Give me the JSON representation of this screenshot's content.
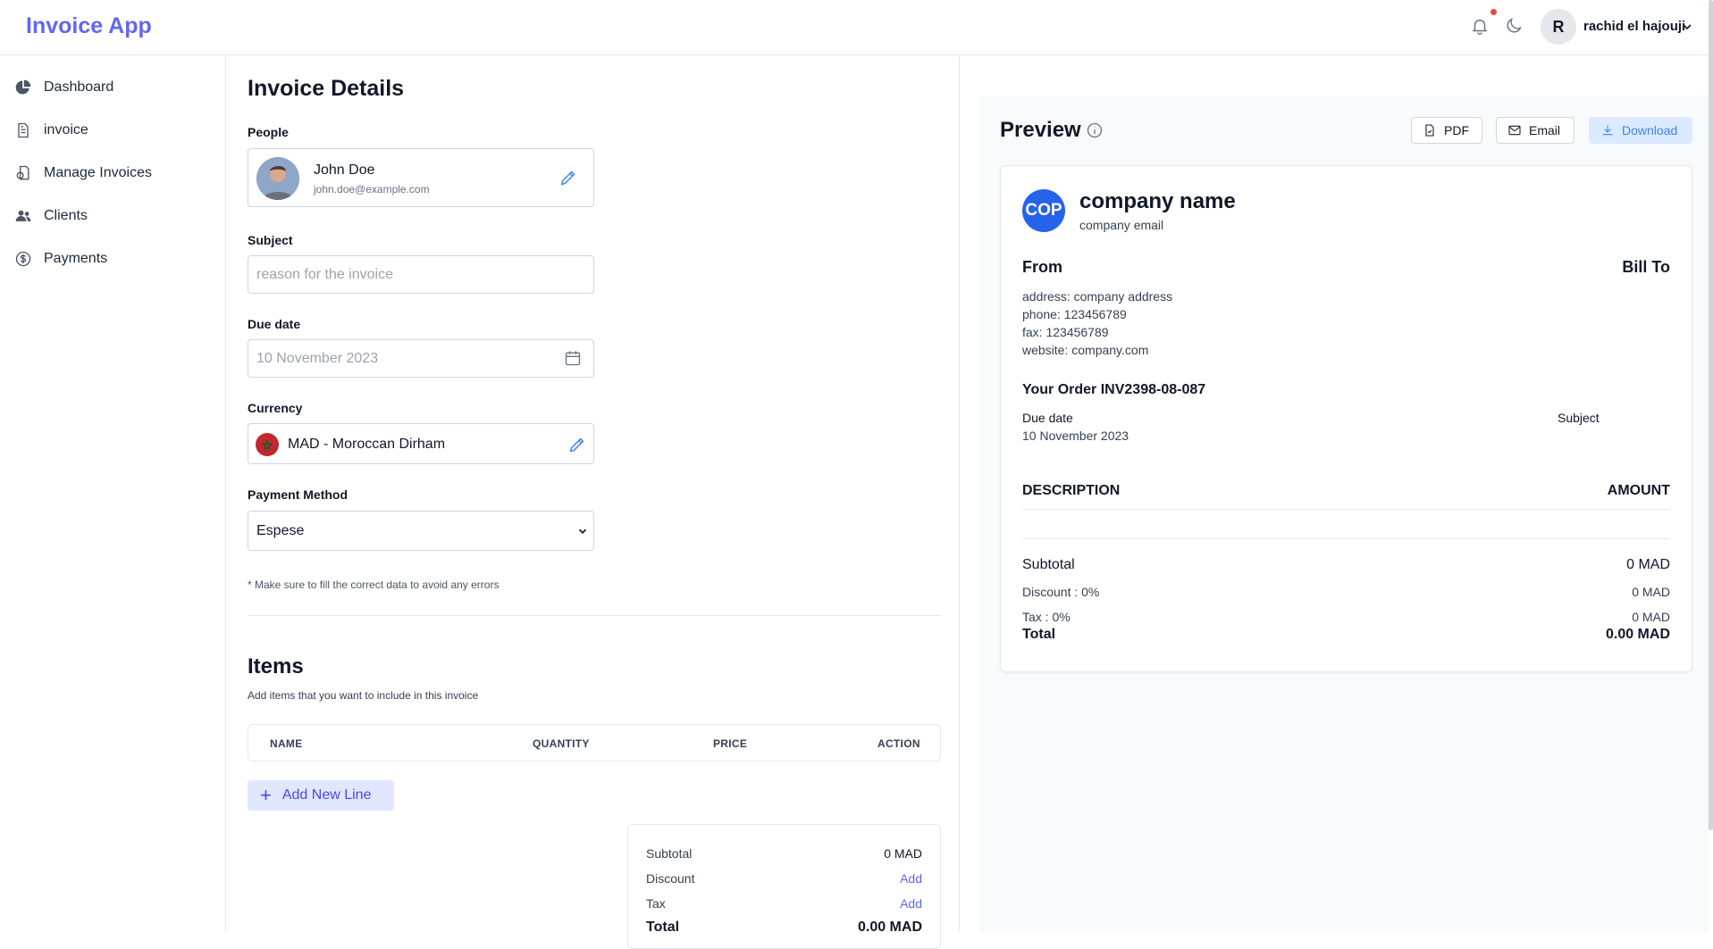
{
  "app": {
    "title": "Invoice App"
  },
  "user": {
    "initial": "R",
    "name": "rachid el hajouji"
  },
  "sidebar": {
    "items": [
      {
        "label": "Dashboard",
        "icon": "pie-chart-icon"
      },
      {
        "label": "invoice",
        "icon": "document-icon"
      },
      {
        "label": "Manage Invoices",
        "icon": "manage-icon"
      },
      {
        "label": "Clients",
        "icon": "users-icon"
      },
      {
        "label": "Payments",
        "icon": "dollar-icon"
      }
    ]
  },
  "form": {
    "title": "Invoice Details",
    "people_label": "People",
    "person": {
      "name": "John Doe",
      "email": "john.doe@example.com"
    },
    "subject_label": "Subject",
    "subject_placeholder": "reason for the invoice",
    "due_label": "Due date",
    "due_value": "10 November 2023",
    "currency_label": "Currency",
    "currency_value": "MAD - Moroccan Dirham",
    "payment_label": "Payment Method",
    "payment_value": "Espese",
    "note": "* Make sure to fill the correct data to avoid any errors"
  },
  "items": {
    "title": "Items",
    "subtitle": "Add items that you want to include in this invoice",
    "columns": [
      "NAME",
      "QUANTITY",
      "PRICE",
      "ACTION"
    ],
    "add_line": "Add New Line",
    "totals": {
      "subtotal_label": "Subtotal",
      "subtotal_value": "0 MAD",
      "discount_label": "Discount",
      "discount_action": "Add",
      "tax_label": "Tax",
      "tax_action": "Add",
      "total_label": "Total",
      "total_value": "0.00 MAD"
    }
  },
  "preview": {
    "title": "Preview",
    "buttons": {
      "pdf": "PDF",
      "email": "Email",
      "download": "Download"
    },
    "company": {
      "badge": "COP",
      "name": "company name",
      "email": "company email"
    },
    "from": "From",
    "bill_to": "Bill To",
    "address": [
      "address: company address",
      "phone: 123456789",
      "fax: 123456789",
      "website: company.com"
    ],
    "order": "Your Order INV2398-08-087",
    "due_label": "Due date",
    "due_value": "10 November 2023",
    "subject_label": "Subject",
    "desc_header": "DESCRIPTION",
    "amount_header": "AMOUNT",
    "subtotal_label": "Subtotal",
    "subtotal_value": "0 MAD",
    "discount_label": "Discount : 0%",
    "discount_value": "0 MAD",
    "tax_label": "Tax : 0%",
    "tax_value": "0 MAD",
    "total_label": "Total",
    "total_value": "0.00 MAD"
  },
  "colors": {
    "accent": "#6366f1",
    "primary_blue": "#2563eb",
    "notification": "#ef4444"
  }
}
